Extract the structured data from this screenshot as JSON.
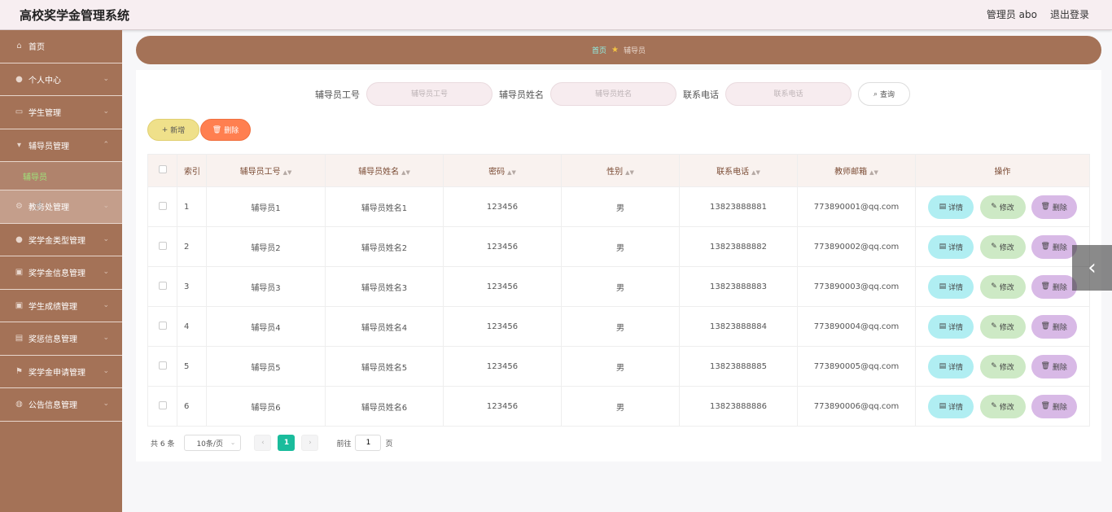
{
  "header": {
    "app_title": "高校奖学金管理系统",
    "user": "管理员 abo",
    "logout": "退出登录"
  },
  "sidebar": {
    "items": [
      {
        "label": "首页",
        "icon": "home-icon"
      },
      {
        "label": "个人中心",
        "icon": "user-icon"
      },
      {
        "label": "学生管理",
        "icon": "chat-icon"
      },
      {
        "label": "辅导员管理",
        "icon": "podium-icon"
      },
      {
        "label": "教务处管理",
        "icon": "gear-icon"
      },
      {
        "label": "奖学金类型管理",
        "icon": "user-icon"
      },
      {
        "label": "奖学金信息管理",
        "icon": "clipboard-icon"
      },
      {
        "label": "学生成绩管理",
        "icon": "clipboard-icon"
      },
      {
        "label": "奖惩信息管理",
        "icon": "printer-icon"
      },
      {
        "label": "奖学金申请管理",
        "icon": "flag-icon"
      },
      {
        "label": "公告信息管理",
        "icon": "globe-icon"
      }
    ],
    "sub_active": "辅导员"
  },
  "breadcrumb": {
    "home": "首页",
    "current": "辅导员"
  },
  "search": {
    "f1_label": "辅导员工号",
    "f1_placeholder": "辅导员工号",
    "f2_label": "辅导员姓名",
    "f2_placeholder": "辅导员姓名",
    "f3_label": "联系电话",
    "f3_placeholder": "联系电话",
    "button": "查询"
  },
  "actions": {
    "add": "新增",
    "delete": "删除"
  },
  "table": {
    "headers": {
      "index": "索引",
      "no": "辅导员工号",
      "name": "辅导员姓名",
      "pwd": "密码",
      "sex": "性别",
      "phone": "联系电话",
      "email": "教师邮箱",
      "ops": "操作"
    },
    "rows": [
      {
        "index": "1",
        "no": "辅导员1",
        "name": "辅导员姓名1",
        "pwd": "123456",
        "sex": "男",
        "phone": "13823888881",
        "email": "773890001@qq.com"
      },
      {
        "index": "2",
        "no": "辅导员2",
        "name": "辅导员姓名2",
        "pwd": "123456",
        "sex": "男",
        "phone": "13823888882",
        "email": "773890002@qq.com"
      },
      {
        "index": "3",
        "no": "辅导员3",
        "name": "辅导员姓名3",
        "pwd": "123456",
        "sex": "男",
        "phone": "13823888883",
        "email": "773890003@qq.com"
      },
      {
        "index": "4",
        "no": "辅导员4",
        "name": "辅导员姓名4",
        "pwd": "123456",
        "sex": "男",
        "phone": "13823888884",
        "email": "773890004@qq.com"
      },
      {
        "index": "5",
        "no": "辅导员5",
        "name": "辅导员姓名5",
        "pwd": "123456",
        "sex": "男",
        "phone": "13823888885",
        "email": "773890005@qq.com"
      },
      {
        "index": "6",
        "no": "辅导员6",
        "name": "辅导员姓名6",
        "pwd": "123456",
        "sex": "男",
        "phone": "13823888886",
        "email": "773890006@qq.com"
      }
    ],
    "op_labels": {
      "detail": "详情",
      "edit": "修改",
      "del": "删除"
    }
  },
  "pager": {
    "total": "共 6 条",
    "size": "10条/页",
    "current": "1",
    "goto_prefix": "前往",
    "goto_value": "1",
    "goto_suffix": "页"
  },
  "colors": {
    "brand": "#a47257",
    "accent": "#1abc9c"
  }
}
